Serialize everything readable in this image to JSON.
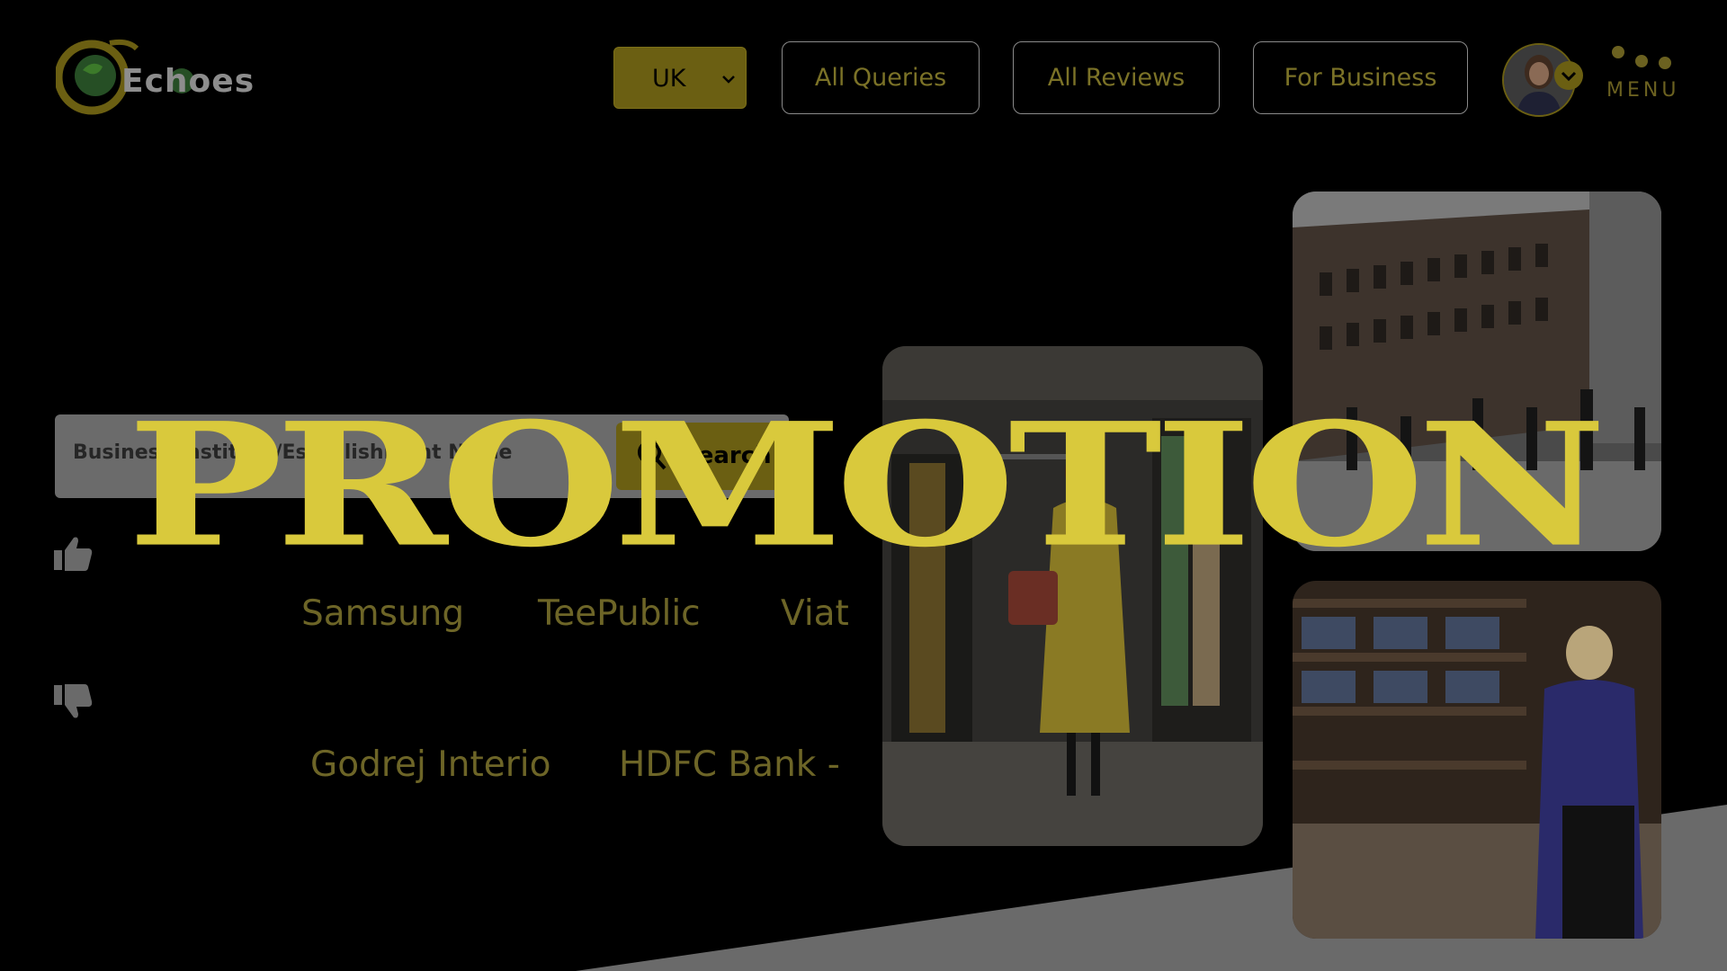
{
  "brand": {
    "name": "Echoes"
  },
  "header": {
    "country_select": "UK",
    "nav": [
      "All Queries",
      "All Reviews",
      "For Business"
    ],
    "menu_label": "MENU"
  },
  "search": {
    "placeholder": "Business/Institute/Establishment Name",
    "button": "Search"
  },
  "businesses": {
    "liked": [
      "Samsung",
      "TeePublic",
      "Viat"
    ],
    "disliked": [
      "Godrej Interio",
      "HDFC Bank -"
    ]
  },
  "overlay": {
    "text": "PROMOTION"
  },
  "colors": {
    "accent": "#d9c93c",
    "gold_dim": "#6b5f12",
    "bg": "#000000"
  },
  "icons": [
    "thumbs-up-icon",
    "thumbs-down-icon",
    "search-icon",
    "chevron-down-icon"
  ]
}
